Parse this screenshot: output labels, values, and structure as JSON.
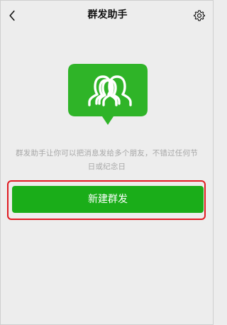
{
  "nav": {
    "title": "群发助手",
    "back_icon": "chevron-left-icon",
    "settings_icon": "gear-icon"
  },
  "main": {
    "hero_icon": "group-chat-users-icon",
    "description": "群发助手让你可以把消息发给多个朋友，不错过任何节日或纪念日",
    "primary_button_label": "新建群发"
  },
  "colors": {
    "background": "#ededed",
    "accent": "#1aad19",
    "hero": "#2fb428",
    "highlight": "#e01b22",
    "text_muted": "#a7a7a7"
  }
}
